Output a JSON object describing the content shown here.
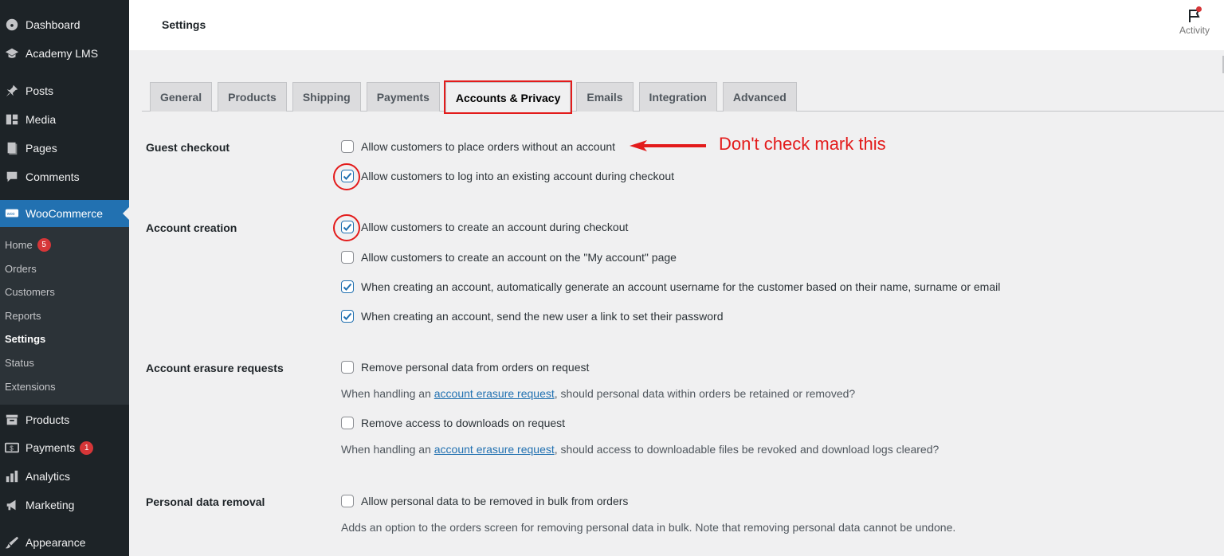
{
  "sidebar": {
    "items": [
      {
        "label": "Dashboard",
        "icon": "dashboard-icon"
      },
      {
        "label": "Academy LMS",
        "icon": "graduation-cap-icon"
      },
      {
        "label": "Posts",
        "icon": "pushpin-icon"
      },
      {
        "label": "Media",
        "icon": "media-icon"
      },
      {
        "label": "Pages",
        "icon": "pages-icon"
      },
      {
        "label": "Comments",
        "icon": "comment-icon"
      },
      {
        "label": "WooCommerce",
        "icon": "woo-icon"
      },
      {
        "label": "Products",
        "icon": "archive-icon"
      },
      {
        "label": "Payments",
        "icon": "payments-icon",
        "badge": "1"
      },
      {
        "label": "Analytics",
        "icon": "bar-chart-icon"
      },
      {
        "label": "Marketing",
        "icon": "megaphone-icon"
      },
      {
        "label": "Appearance",
        "icon": "brush-icon"
      }
    ],
    "submenu": [
      {
        "label": "Home",
        "badge": "5"
      },
      {
        "label": "Orders"
      },
      {
        "label": "Customers"
      },
      {
        "label": "Reports"
      },
      {
        "label": "Settings"
      },
      {
        "label": "Status"
      },
      {
        "label": "Extensions"
      }
    ]
  },
  "header": {
    "title": "Settings",
    "activity_label": "Activity"
  },
  "tabs": [
    "General",
    "Products",
    "Shipping",
    "Payments",
    "Accounts & Privacy",
    "Emails",
    "Integration",
    "Advanced"
  ],
  "active_tab": "Accounts & Privacy",
  "sections": {
    "guest_checkout": {
      "label": "Guest checkout",
      "options": [
        {
          "label": "Allow customers to place orders without an account",
          "checked": false
        },
        {
          "label": "Allow customers to log into an existing account during checkout",
          "checked": true
        }
      ]
    },
    "account_creation": {
      "label": "Account creation",
      "options": [
        {
          "label": "Allow customers to create an account during checkout",
          "checked": true
        },
        {
          "label": "Allow customers to create an account on the \"My account\" page",
          "checked": false
        },
        {
          "label": "When creating an account, automatically generate an account username for the customer based on their name, surname or email",
          "checked": true
        },
        {
          "label": "When creating an account, send the new user a link to set their password",
          "checked": true
        }
      ]
    },
    "erasure": {
      "label": "Account erasure requests",
      "options": [
        {
          "label": "Remove personal data from orders on request",
          "checked": false
        },
        {
          "label": "Remove access to downloads on request",
          "checked": false
        }
      ],
      "desc1_pre": "When handling an ",
      "desc1_link": "account erasure request",
      "desc1_post": ", should personal data within orders be retained or removed?",
      "desc2_pre": "When handling an ",
      "desc2_link": "account erasure request",
      "desc2_post": ", should access to downloadable files be revoked and download logs cleared?"
    },
    "removal": {
      "label": "Personal data removal",
      "options": [
        {
          "label": "Allow personal data to be removed in bulk from orders",
          "checked": false
        }
      ],
      "desc": "Adds an option to the orders screen for removing personal data in bulk. Note that removing personal data cannot be undone."
    }
  },
  "annotation": {
    "text": "Don't check mark this",
    "color": "#e31b1b"
  },
  "colors": {
    "sidebar_bg": "#1d2327",
    "accent": "#2271b1",
    "highlight": "#e31b1b"
  }
}
